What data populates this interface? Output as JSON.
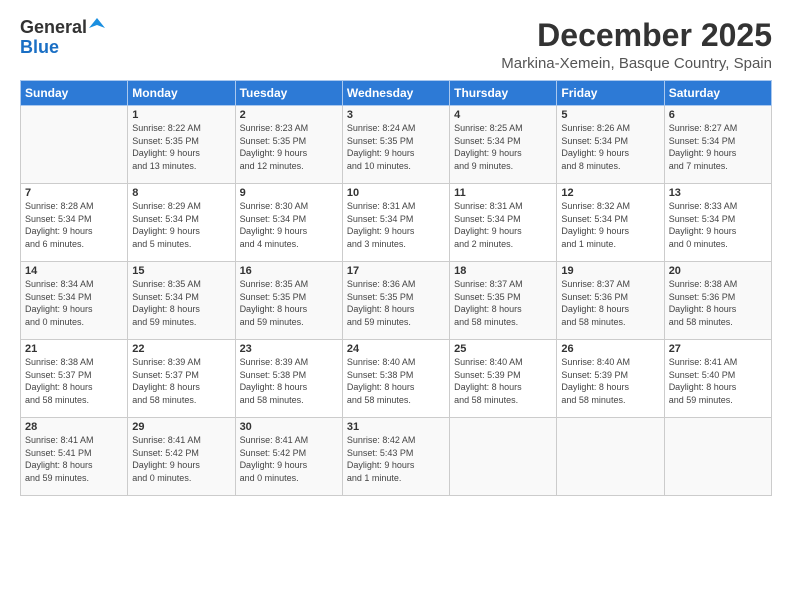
{
  "header": {
    "logo_general": "General",
    "logo_blue": "Blue",
    "title": "December 2025",
    "subtitle": "Markina-Xemein, Basque Country, Spain"
  },
  "calendar": {
    "days_of_week": [
      "Sunday",
      "Monday",
      "Tuesday",
      "Wednesday",
      "Thursday",
      "Friday",
      "Saturday"
    ],
    "weeks": [
      [
        {
          "day": "",
          "info": ""
        },
        {
          "day": "1",
          "info": "Sunrise: 8:22 AM\nSunset: 5:35 PM\nDaylight: 9 hours\nand 13 minutes."
        },
        {
          "day": "2",
          "info": "Sunrise: 8:23 AM\nSunset: 5:35 PM\nDaylight: 9 hours\nand 12 minutes."
        },
        {
          "day": "3",
          "info": "Sunrise: 8:24 AM\nSunset: 5:35 PM\nDaylight: 9 hours\nand 10 minutes."
        },
        {
          "day": "4",
          "info": "Sunrise: 8:25 AM\nSunset: 5:34 PM\nDaylight: 9 hours\nand 9 minutes."
        },
        {
          "day": "5",
          "info": "Sunrise: 8:26 AM\nSunset: 5:34 PM\nDaylight: 9 hours\nand 8 minutes."
        },
        {
          "day": "6",
          "info": "Sunrise: 8:27 AM\nSunset: 5:34 PM\nDaylight: 9 hours\nand 7 minutes."
        }
      ],
      [
        {
          "day": "7",
          "info": "Sunrise: 8:28 AM\nSunset: 5:34 PM\nDaylight: 9 hours\nand 6 minutes."
        },
        {
          "day": "8",
          "info": "Sunrise: 8:29 AM\nSunset: 5:34 PM\nDaylight: 9 hours\nand 5 minutes."
        },
        {
          "day": "9",
          "info": "Sunrise: 8:30 AM\nSunset: 5:34 PM\nDaylight: 9 hours\nand 4 minutes."
        },
        {
          "day": "10",
          "info": "Sunrise: 8:31 AM\nSunset: 5:34 PM\nDaylight: 9 hours\nand 3 minutes."
        },
        {
          "day": "11",
          "info": "Sunrise: 8:31 AM\nSunset: 5:34 PM\nDaylight: 9 hours\nand 2 minutes."
        },
        {
          "day": "12",
          "info": "Sunrise: 8:32 AM\nSunset: 5:34 PM\nDaylight: 9 hours\nand 1 minute."
        },
        {
          "day": "13",
          "info": "Sunrise: 8:33 AM\nSunset: 5:34 PM\nDaylight: 9 hours\nand 0 minutes."
        }
      ],
      [
        {
          "day": "14",
          "info": "Sunrise: 8:34 AM\nSunset: 5:34 PM\nDaylight: 9 hours\nand 0 minutes."
        },
        {
          "day": "15",
          "info": "Sunrise: 8:35 AM\nSunset: 5:34 PM\nDaylight: 8 hours\nand 59 minutes."
        },
        {
          "day": "16",
          "info": "Sunrise: 8:35 AM\nSunset: 5:35 PM\nDaylight: 8 hours\nand 59 minutes."
        },
        {
          "day": "17",
          "info": "Sunrise: 8:36 AM\nSunset: 5:35 PM\nDaylight: 8 hours\nand 59 minutes."
        },
        {
          "day": "18",
          "info": "Sunrise: 8:37 AM\nSunset: 5:35 PM\nDaylight: 8 hours\nand 58 minutes."
        },
        {
          "day": "19",
          "info": "Sunrise: 8:37 AM\nSunset: 5:36 PM\nDaylight: 8 hours\nand 58 minutes."
        },
        {
          "day": "20",
          "info": "Sunrise: 8:38 AM\nSunset: 5:36 PM\nDaylight: 8 hours\nand 58 minutes."
        }
      ],
      [
        {
          "day": "21",
          "info": "Sunrise: 8:38 AM\nSunset: 5:37 PM\nDaylight: 8 hours\nand 58 minutes."
        },
        {
          "day": "22",
          "info": "Sunrise: 8:39 AM\nSunset: 5:37 PM\nDaylight: 8 hours\nand 58 minutes."
        },
        {
          "day": "23",
          "info": "Sunrise: 8:39 AM\nSunset: 5:38 PM\nDaylight: 8 hours\nand 58 minutes."
        },
        {
          "day": "24",
          "info": "Sunrise: 8:40 AM\nSunset: 5:38 PM\nDaylight: 8 hours\nand 58 minutes."
        },
        {
          "day": "25",
          "info": "Sunrise: 8:40 AM\nSunset: 5:39 PM\nDaylight: 8 hours\nand 58 minutes."
        },
        {
          "day": "26",
          "info": "Sunrise: 8:40 AM\nSunset: 5:39 PM\nDaylight: 8 hours\nand 58 minutes."
        },
        {
          "day": "27",
          "info": "Sunrise: 8:41 AM\nSunset: 5:40 PM\nDaylight: 8 hours\nand 59 minutes."
        }
      ],
      [
        {
          "day": "28",
          "info": "Sunrise: 8:41 AM\nSunset: 5:41 PM\nDaylight: 8 hours\nand 59 minutes."
        },
        {
          "day": "29",
          "info": "Sunrise: 8:41 AM\nSunset: 5:42 PM\nDaylight: 9 hours\nand 0 minutes."
        },
        {
          "day": "30",
          "info": "Sunrise: 8:41 AM\nSunset: 5:42 PM\nDaylight: 9 hours\nand 0 minutes."
        },
        {
          "day": "31",
          "info": "Sunrise: 8:42 AM\nSunset: 5:43 PM\nDaylight: 9 hours\nand 1 minute."
        },
        {
          "day": "",
          "info": ""
        },
        {
          "day": "",
          "info": ""
        },
        {
          "day": "",
          "info": ""
        }
      ]
    ]
  }
}
